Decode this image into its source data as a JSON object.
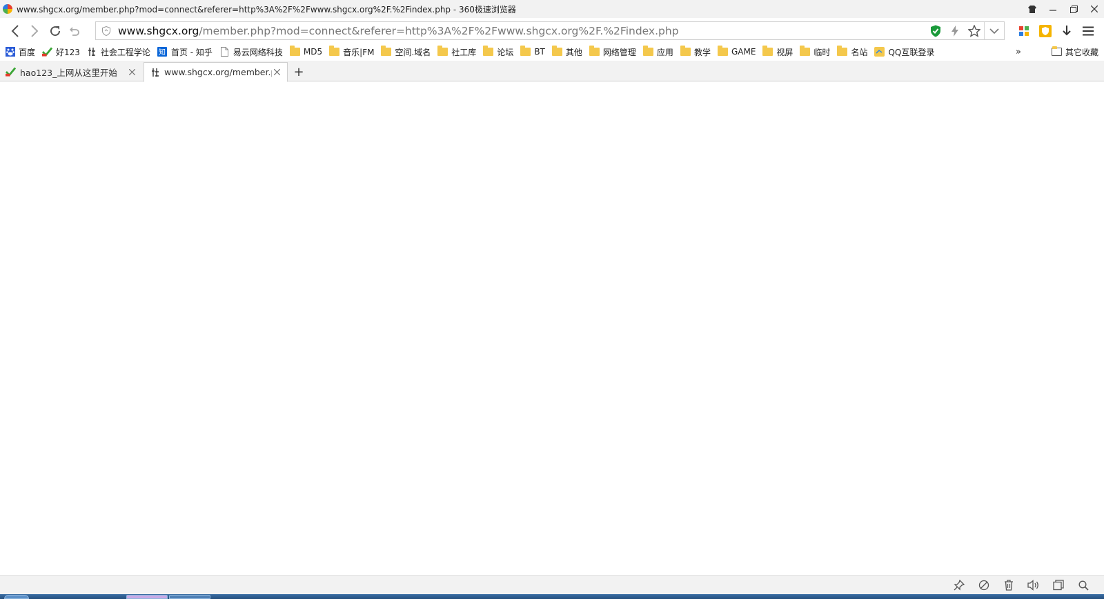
{
  "window": {
    "title": "www.shgcx.org/member.php?mod=connect&referer=http%3A%2F%2Fwww.shgcx.org%2F.%2Findex.php - 360极速浏览器"
  },
  "addressbar": {
    "url_host": "www.shgcx.org",
    "url_path": "/member.php?mod=connect&referer=http%3A%2F%2Fwww.shgcx.org%2F.%2Findex.php"
  },
  "bookmarks": {
    "items": [
      {
        "label": "百度",
        "icon": "baidu-icon"
      },
      {
        "label": "好123",
        "icon": "hao123-icon"
      },
      {
        "label": "社会工程学论",
        "icon": "shgcx-icon"
      },
      {
        "label": "首页 - 知乎",
        "icon": "zhihu-icon"
      },
      {
        "label": "易云网络科技",
        "icon": "page-icon"
      },
      {
        "label": "MD5",
        "icon": "folder-icon"
      },
      {
        "label": "音乐|FM",
        "icon": "folder-icon"
      },
      {
        "label": "空间.域名",
        "icon": "folder-icon"
      },
      {
        "label": "社工库",
        "icon": "folder-icon"
      },
      {
        "label": "论坛",
        "icon": "folder-icon"
      },
      {
        "label": "BT",
        "icon": "folder-icon"
      },
      {
        "label": "其他",
        "icon": "folder-icon"
      },
      {
        "label": "网络管理",
        "icon": "folder-icon"
      },
      {
        "label": "应用",
        "icon": "folder-icon"
      },
      {
        "label": "教学",
        "icon": "folder-icon"
      },
      {
        "label": "GAME",
        "icon": "folder-icon"
      },
      {
        "label": "视屏",
        "icon": "folder-icon"
      },
      {
        "label": "临时",
        "icon": "folder-icon"
      },
      {
        "label": "名站",
        "icon": "folder-icon"
      },
      {
        "label": "QQ互联登录",
        "icon": "qq-connect-icon"
      }
    ],
    "more": "»",
    "other": "其它收藏"
  },
  "tabs": [
    {
      "label": "hao123_上网从这里开始",
      "active": false
    },
    {
      "label": "www.shgcx.org/member.p",
      "active": true
    }
  ],
  "new_tab": "+",
  "colors": {
    "chrome_bg": "#f2f2f2",
    "folder": "#f4c84c",
    "shield_green": "#1a9a3a",
    "taskbar": "#2d5d91"
  }
}
